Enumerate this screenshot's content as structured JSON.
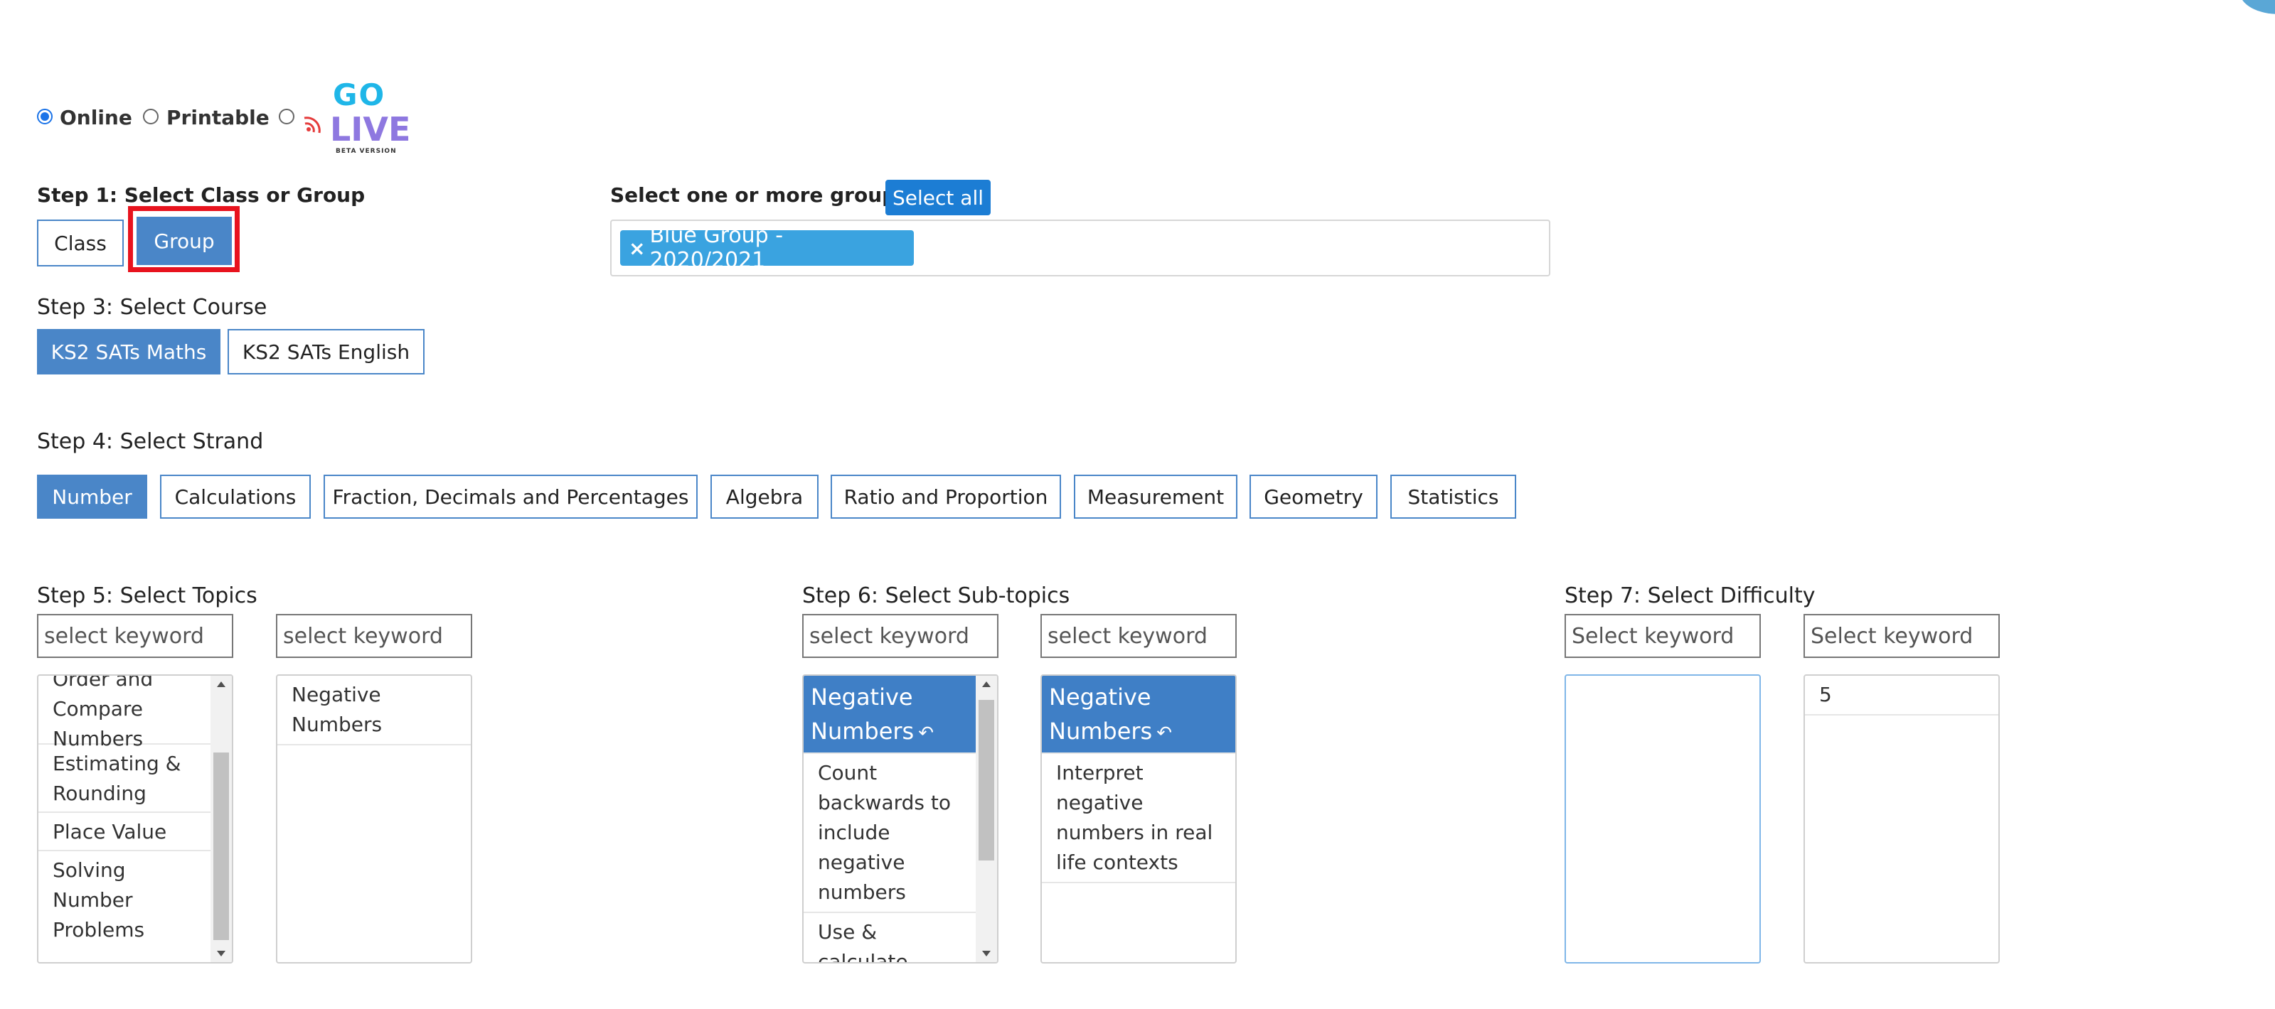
{
  "mode": {
    "options": [
      {
        "label": "Online",
        "checked": true
      },
      {
        "label": "Printable",
        "checked": false
      },
      {
        "label": "",
        "checked": false
      }
    ],
    "logo": {
      "top": "GO",
      "bottom": "LIVE",
      "sub": "BETA VERSION"
    }
  },
  "step1": {
    "label": "Step 1: Select Class or Group",
    "buttons": [
      "Class",
      "Group"
    ],
    "active": "Group"
  },
  "groups": {
    "label": "Select one or more groups",
    "select_all": "Select all",
    "selected": [
      "Blue Group - 2020/2021"
    ],
    "remove_icon": "×"
  },
  "step3": {
    "label": "Step 3: Select Course",
    "buttons": [
      "KS2 SATs Maths",
      "KS2 SATs English"
    ],
    "active": "KS2 SATs Maths"
  },
  "step4": {
    "label": "Step 4: Select Strand",
    "buttons": [
      "Number",
      "Calculations",
      "Fraction, Decimals and Percentages",
      "Algebra",
      "Ratio and Proportion",
      "Measurement",
      "Geometry",
      "Statistics"
    ],
    "active": "Number"
  },
  "step5": {
    "label": "Step 5: Select Topics",
    "keyword_left": "select keyword",
    "keyword_right": "select keyword",
    "topics": [
      "Order and Compare Numbers",
      "Estimating & Rounding",
      "Place Value",
      "Solving Number Problems"
    ],
    "selected_topics": [
      "Negative Numbers"
    ]
  },
  "step6": {
    "label": "Step 6: Select Sub-topics",
    "keyword_left": "select keyword",
    "keyword_right": "select keyword",
    "left_header": "Negative Numbers",
    "subtopics": [
      "Count backwards to include negative numbers",
      "Use & calculate"
    ],
    "right_header": "Negative Numbers",
    "selected_subtopics": [
      "Interpret negative numbers in real life contexts"
    ]
  },
  "step7": {
    "label": "Step 7: Select Difficulty",
    "keyword_left": "Select keyword",
    "keyword_right": "Select keyword",
    "difficulties": [],
    "selected_difficulties": [
      "5"
    ]
  },
  "colors": {
    "accent": "#4a86c8",
    "primary": "#1c7dd4",
    "highlight": "#e8131e",
    "chip": "#3aa3e0"
  }
}
